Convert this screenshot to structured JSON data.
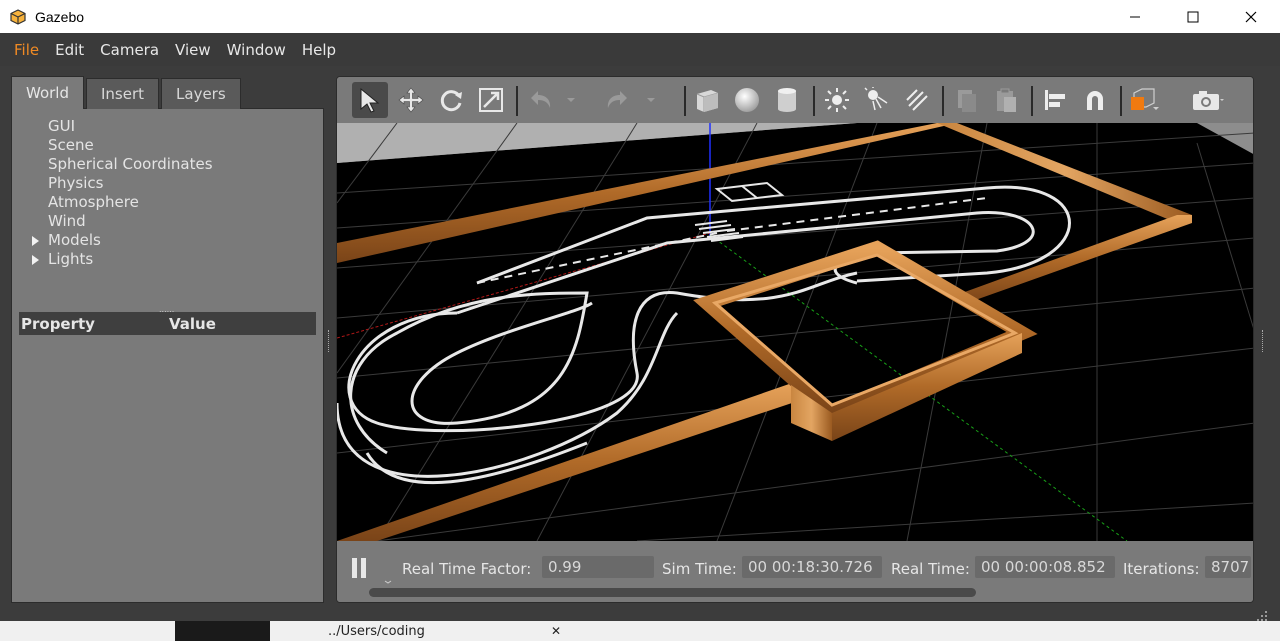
{
  "window": {
    "title": "Gazebo"
  },
  "menu": [
    "File",
    "Edit",
    "Camera",
    "View",
    "Window",
    "Help"
  ],
  "left_panel": {
    "tabs": [
      "World",
      "Insert",
      "Layers"
    ],
    "tree": [
      {
        "label": "GUI",
        "expandable": false
      },
      {
        "label": "Scene",
        "expandable": false
      },
      {
        "label": "Spherical Coordinates",
        "expandable": false
      },
      {
        "label": "Physics",
        "expandable": false
      },
      {
        "label": "Atmosphere",
        "expandable": false
      },
      {
        "label": "Wind",
        "expandable": false
      },
      {
        "label": "Models",
        "expandable": true
      },
      {
        "label": "Lights",
        "expandable": true
      }
    ],
    "splitter_dots": "......",
    "property_header": {
      "property": "Property",
      "value": "Value"
    }
  },
  "toolbar": {
    "icons": [
      "select-arrow-icon",
      "translate-icon",
      "rotate-icon",
      "scale-icon",
      "undo-icon",
      "redo-icon",
      "box-icon",
      "sphere-icon",
      "cylinder-icon",
      "point-light-icon",
      "spot-light-icon",
      "directional-light-icon",
      "copy-icon",
      "paste-icon",
      "align-icon",
      "snap-icon",
      "view-angle-icon",
      "screenshot-icon"
    ]
  },
  "status": {
    "real_time_factor_label": "Real Time Factor:",
    "real_time_factor": "0.99",
    "sim_time_label": "Sim Time:",
    "sim_time": "00 00:18:30.726",
    "real_time_label": "Real Time:",
    "real_time": "00 00:00:08.852",
    "iterations_label": "Iterations:",
    "iterations": "8707"
  },
  "taskbar": {
    "path_text": "../Users/coding"
  },
  "colors": {
    "menu_active": "#f08a24",
    "panel_bg": "#7a7a7a",
    "scene_bg": "#000000",
    "wall_wood": "#c07a35",
    "grid": "#3a3a3a"
  }
}
